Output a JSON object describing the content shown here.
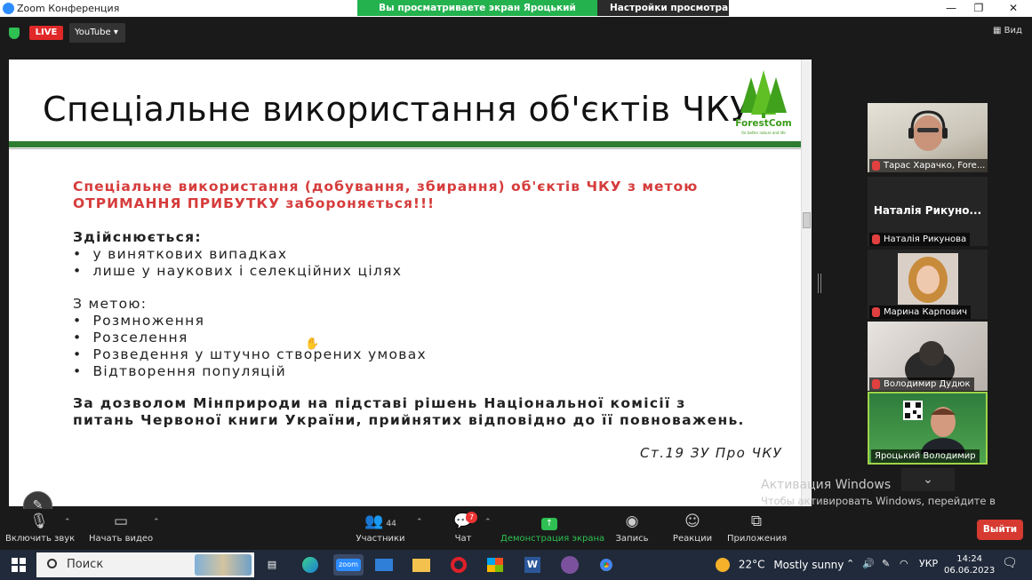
{
  "window": {
    "title": "Zoom Конференция",
    "share_banner": "Вы просматриваете экран Яроцький Володимир",
    "view_options": "Настройки просмотра",
    "controls": {
      "minimize": "—",
      "restore": "❐",
      "close": "✕"
    }
  },
  "header": {
    "live": "LIVE",
    "stream_target": "YouTube ▾",
    "view": "Вид"
  },
  "slide": {
    "title": "Спеціальне використання об'єктів ЧКУ",
    "logo_text": "ForestCom",
    "logo_subtext": "for better nature and life",
    "warning": "Спеціальне використання (добування, збирання) об'єктів ЧКУ з метою ОТРИМАННЯ ПРИБУТКУ забороняється!!!",
    "section1_heading": "Здійснюється:",
    "section1_items": [
      "у виняткових випадках",
      "лише у наукових і селекційних цілях"
    ],
    "section2_heading": "З метою:",
    "section2_items": [
      "Розмноження",
      "Розселення",
      "Розведення у штучно створених умовах",
      "Відтворення популяцій"
    ],
    "permission": "За дозволом Мінприроди на підставі рішень Національної комісії з питань Червоної книги України, прийнятих відповідно до її повноважень.",
    "citation": "Ст.19 ЗУ Про ЧКУ"
  },
  "participants": [
    {
      "name": "Тарас Харачко, Fore..."
    },
    {
      "name": "Наталія Рикунова",
      "display_name": "Наталія  Рикуно..."
    },
    {
      "name": "Марина Карпович"
    },
    {
      "name": "Володимир Дудюк"
    },
    {
      "name": "Яроцький Володимир"
    }
  ],
  "activation": {
    "title": "Активация Windows",
    "message": "Чтобы активировать Windows, перейдите в раздел \"Параметры\"."
  },
  "toolbar": {
    "audio": "Включить звук",
    "video": "Начать видео",
    "participants": "Участники",
    "participants_count": "44",
    "chat": "Чат",
    "chat_badge": "7",
    "share": "Демонстрация экрана",
    "record": "Запись",
    "reactions": "Реакции",
    "apps": "Приложения",
    "leave": "Выйти"
  },
  "taskbar": {
    "search_placeholder": "Поиск",
    "zoom_label": "zoom",
    "weather_temp": "22°C",
    "weather_desc": "Mostly sunny",
    "language": "УКР",
    "time": "14:24",
    "date": "06.06.2023"
  },
  "colors": {
    "share_green": "#24b24f",
    "live_red": "#e02828",
    "slide_green": "#2e7d32",
    "warning_red": "#d63c3c",
    "leave_red": "#d63a30"
  }
}
